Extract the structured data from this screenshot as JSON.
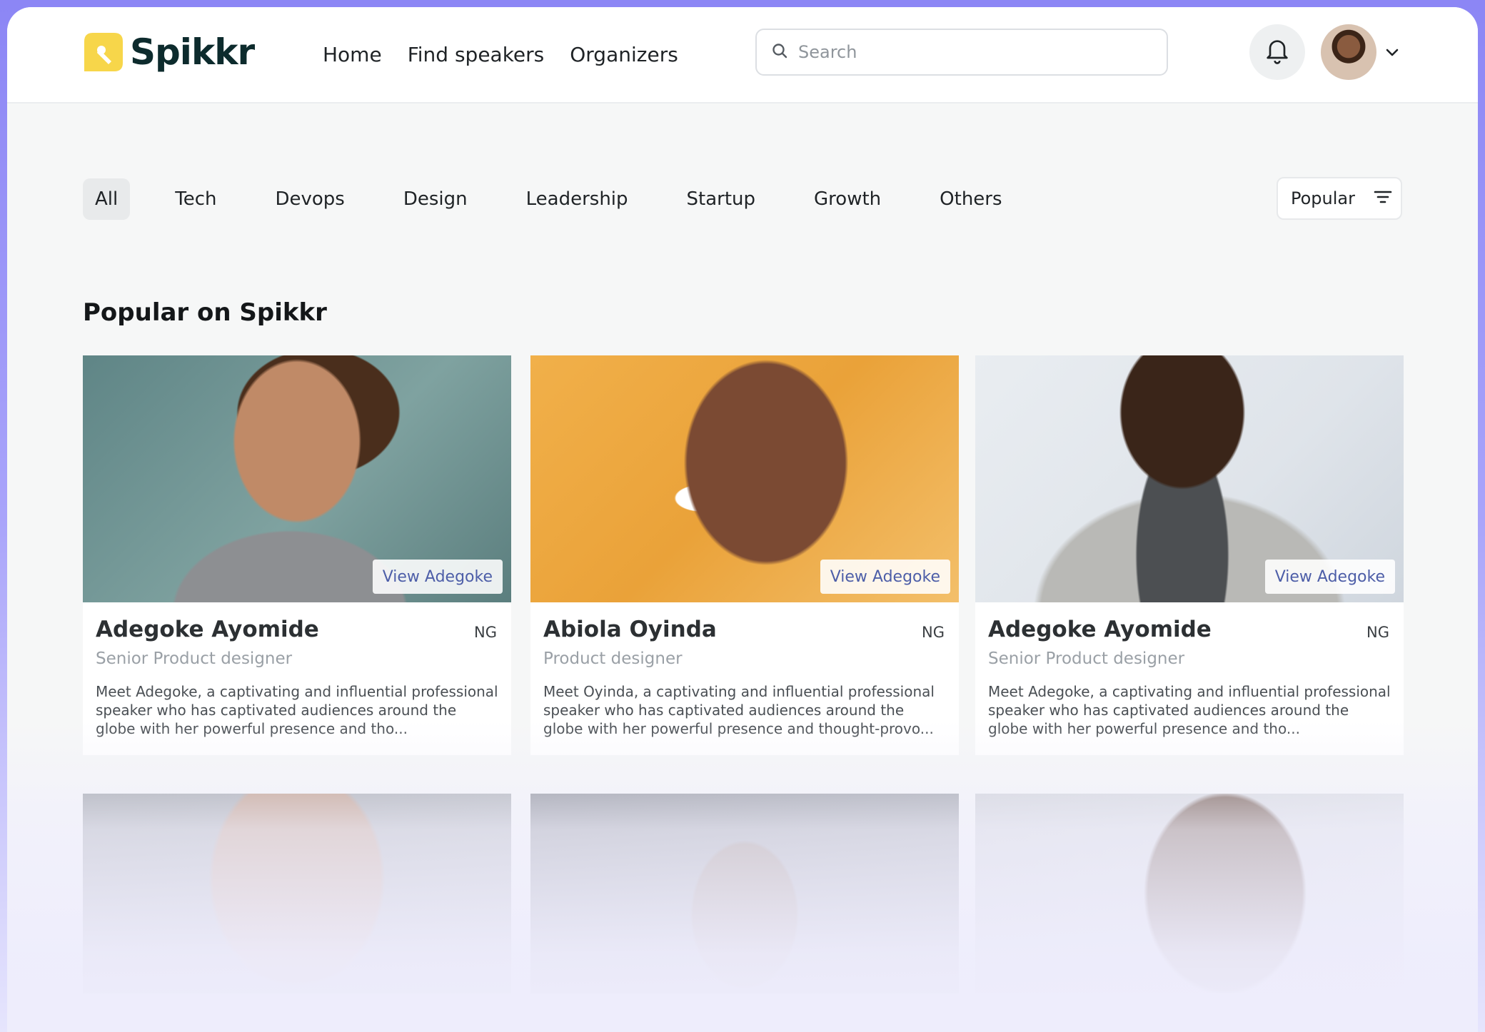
{
  "brand": {
    "name": "Spikkr",
    "accent": "#f7d64a",
    "dark": "#0d2b2d"
  },
  "nav": {
    "items": [
      "Home",
      "Find speakers",
      "Organizers"
    ]
  },
  "search": {
    "placeholder": "Search",
    "value": ""
  },
  "filters": {
    "categories": [
      "All",
      "Tech",
      "Devops",
      "Design",
      "Leadership",
      "Startup",
      "Growth",
      "Others"
    ],
    "active": "All",
    "sort_label": "Popular"
  },
  "section": {
    "title": "Popular on Spikkr"
  },
  "speakers": [
    {
      "name": "Adegoke Ayomide",
      "country": "NG",
      "role": "Senior Product designer",
      "bio": "Meet Adegoke, a captivating and influential professional speaker who has captivated audiences around the globe with her powerful presence and tho...",
      "view_label": "View Adegoke"
    },
    {
      "name": "Abiola Oyinda",
      "country": "NG",
      "role": "Product designer",
      "bio": "Meet Oyinda, a captivating and influential professional speaker who has captivated audiences around the globe with her powerful presence and thought-provo...",
      "view_label": "View Adegoke"
    },
    {
      "name": "Adegoke Ayomide",
      "country": "NG",
      "role": "Senior Product designer",
      "bio": "Meet Adegoke, a captivating and influential professional speaker who has captivated audiences around the globe with her powerful presence and tho...",
      "view_label": "View Adegoke"
    }
  ],
  "icons": [
    "search-icon",
    "bell-icon",
    "chevron-down-icon",
    "filter-icon"
  ]
}
